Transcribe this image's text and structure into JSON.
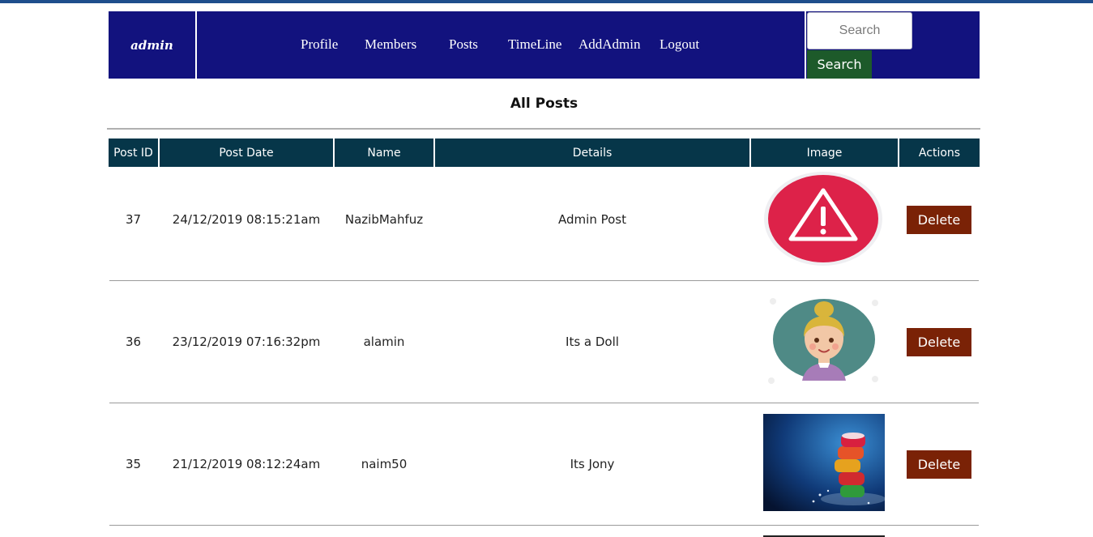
{
  "navbar": {
    "brand": "admin",
    "links": [
      "Profile",
      "Members",
      "Posts",
      "TimeLine",
      "AddAdmin",
      "Logout"
    ],
    "search_placeholder": "Search",
    "search_button": "Search"
  },
  "page_title": "All Posts",
  "table": {
    "headers": [
      "Post ID",
      "Post Date",
      "Name",
      "Details",
      "Image",
      "Actions"
    ],
    "rows": [
      {
        "id": "37",
        "date": "24/12/2019 08:15:21am",
        "name": "NazibMahfuz",
        "details": "Admin Post",
        "image": "warning-icon-image",
        "action": "Delete"
      },
      {
        "id": "36",
        "date": "23/12/2019 07:16:32pm",
        "name": "alamin",
        "details": "Its a Doll",
        "image": "doll-avatar-image",
        "action": "Delete"
      },
      {
        "id": "35",
        "date": "21/12/2019 08:12:24am",
        "name": "naim50",
        "details": "Its Jony",
        "image": "candy-stack-photo",
        "action": "Delete"
      }
    ]
  },
  "colors": {
    "navbar": "#12127e",
    "table_header": "#063649",
    "search_button": "#1d5a2a",
    "delete_button": "#7a2206",
    "warning_red": "#dd2249"
  }
}
